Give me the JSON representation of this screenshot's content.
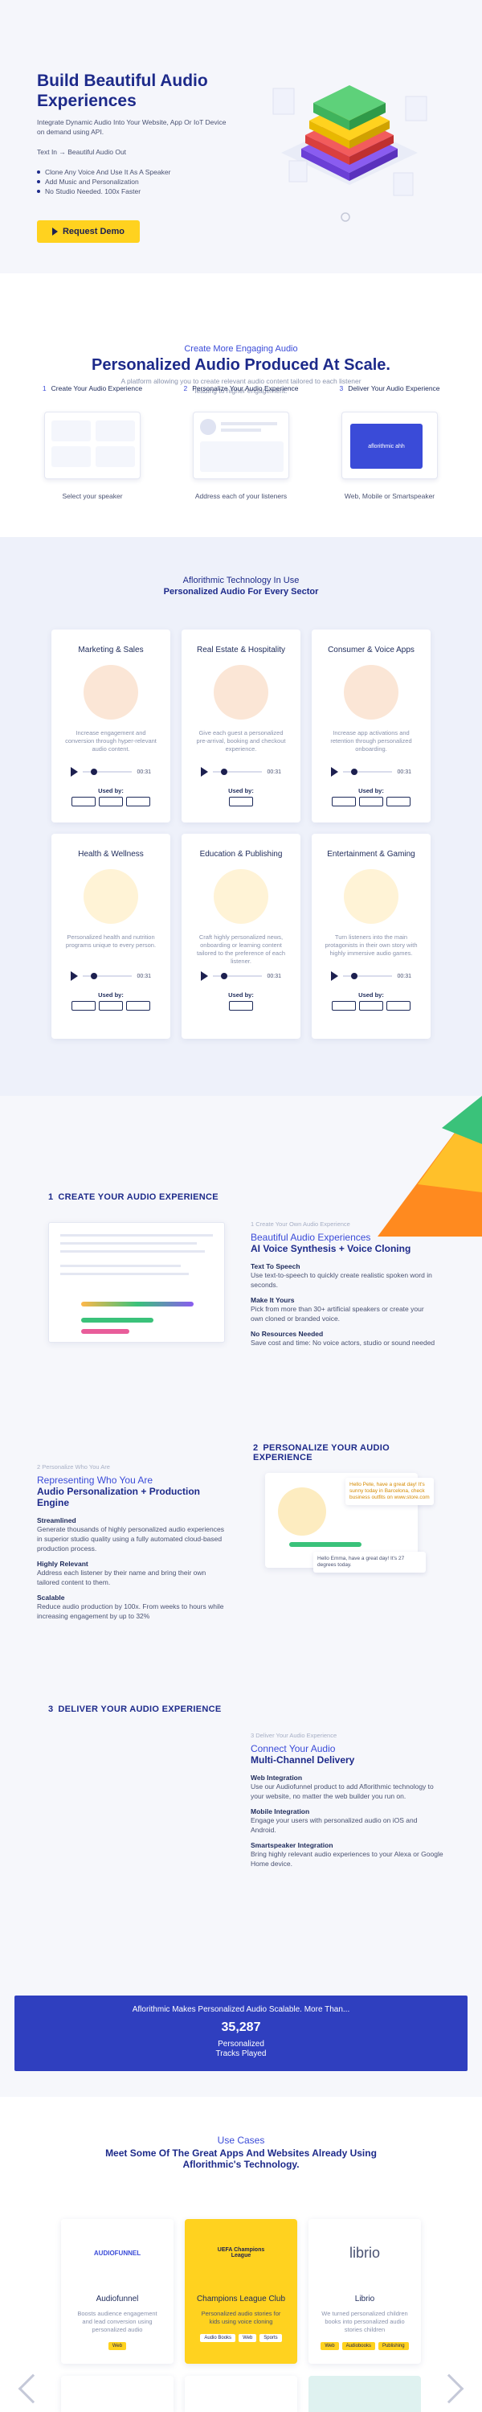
{
  "hero": {
    "title": "Build Beautiful Audio Experiences",
    "subtitle": "Integrate Dynamic Audio Into Your Website, App Or IoT Device on demand using API.",
    "flow": "Text In → Beautiful Audio Out",
    "bullets": [
      "Clone Any Voice And Use It As A Speaker",
      "Add Music and Personalization",
      "No Studio Needed. 100x Faster"
    ],
    "cta": "Request Demo"
  },
  "engaging": {
    "eyebrow": "Create More Engaging Audio",
    "title": "Personalized Audio Produced At Scale.",
    "description": "A platform allowing you to create relevant audio content tailored to each listener leading to higher engagement.",
    "steps": [
      {
        "number": "1",
        "title": "Create Your Audio Experience",
        "caption": "Select your speaker"
      },
      {
        "number": "2",
        "title": "Personalize Your Audio Experience",
        "caption": "Address each of your listeners"
      },
      {
        "number": "3",
        "title": "Deliver Your Audio Experience",
        "caption": "Web, Mobile or Smartspeaker"
      }
    ],
    "mock_text_3": "aflorithmic ahh"
  },
  "sectors": {
    "eyebrow": "Aflorithmic Technology In Use",
    "title": "Personalized Audio For Every Sector",
    "used_by": "Used by:",
    "time": "00:31",
    "cards": [
      {
        "title": "Marketing & Sales",
        "description": "Increase engagement and conversion through hyper-relevant audio content."
      },
      {
        "title": "Real Estate & Hospitality",
        "description": "Give each guest a personalized pre-arrival, booking and checkout experience."
      },
      {
        "title": "Consumer & Voice Apps",
        "description": "Increase app activations and retention through personalized onboarding."
      },
      {
        "title": "Health & Wellness",
        "description": "Personalized health and nutrition programs unique to every person."
      },
      {
        "title": "Education & Publishing",
        "description": "Craft highly personalized news, onboarding or learning content tailored to the preference of each listener."
      },
      {
        "title": "Entertainment & Gaming",
        "description": "Turn listeners into the main protagonists in their own story with highly immersive audio games."
      }
    ]
  },
  "features": {
    "create": {
      "heading_number": "1",
      "heading": "CREATE YOUR AUDIO EXPERIENCE",
      "eyebrow": "1 Create Your Own Audio Experience",
      "title_line1": "Beautiful Audio Experiences",
      "title_line2": "AI Voice Synthesis + Voice Cloning",
      "items": [
        {
          "h": "Text To Speech",
          "p": "Use text-to-speech to quickly create realistic spoken word in seconds."
        },
        {
          "h": "Make It Yours",
          "p": "Pick from more than 30+ artificial speakers or create your own cloned or branded voice."
        },
        {
          "h": "No Resources Needed",
          "p": "Save cost and time: No voice actors, studio or sound needed"
        }
      ]
    },
    "personalize": {
      "heading_number": "2",
      "heading": "PERSONALIZE YOUR AUDIO EXPERIENCE",
      "eyebrow": "2 Personalize Who You Are",
      "title_line1": "Representing Who You Are",
      "title_line2": "Audio Personalization + Production Engine",
      "items": [
        {
          "h": "Streamlined",
          "p": "Generate thousands of highly personalized audio experiences in superior studio quality using a fully automated cloud-based production process."
        },
        {
          "h": "Highly Relevant",
          "p": "Address each listener by their name and bring their own tailored content to them."
        },
        {
          "h": "Scalable",
          "p": "Reduce audio production by 100x. From weeks to hours while increasing engagement by up to 32%"
        }
      ],
      "bubble1": "Hello Pete, have a great day! It's sunny today in Barcelona, check business outfits on www.store.com",
      "bubble2": "Hello Emma, have a great day! It's 27 degrees today."
    },
    "deliver": {
      "heading_number": "3",
      "heading": "DELIVER YOUR AUDIO EXPERIENCE",
      "eyebrow": "3 Deliver Your Audio Experience",
      "title_line1": "Connect Your Audio",
      "title_line2": "Multi-Channel Delivery",
      "items": [
        {
          "h": "Web Integration",
          "p": "Use our Audiofunnel product to add Aflorithmic technology to your website, no matter the web builder you run on."
        },
        {
          "h": "Mobile Integration",
          "p": "Engage your users with personalized audio on iOS and Android."
        },
        {
          "h": "Smartspeaker Integration",
          "p": "Bring highly relevant audio experiences to your Alexa or Google Home device."
        }
      ]
    }
  },
  "stats": {
    "headline": "Aflorithmic Makes Personalized Audio Scalable. More Than...",
    "value": "35,287",
    "label1": "Personalized",
    "label2": "Tracks Played"
  },
  "use_cases": {
    "eyebrow": "Use Cases",
    "title": "Meet Some Of The Great Apps And Websites Already Using Aflorithmic's Technology.",
    "cards": [
      {
        "logo": "AUDIOFUNNEL",
        "name": "Audiofunnel",
        "description": "Boosts audience engagement and lead conversion using personalized audio",
        "tags": [
          "Web"
        ]
      },
      {
        "logo": "UEFA Champions League",
        "name": "Champions League Club",
        "description": "Personalized audio stories for kids using voice cloning",
        "tags": [
          "Audio Books",
          "Web",
          "Sports"
        ]
      },
      {
        "logo": "librio",
        "name": "Librio",
        "description": "We turned personalized children books into personalized audio stories children",
        "tags": [
          "Web",
          "Audiobooks",
          "Publishing"
        ]
      }
    ]
  },
  "colors": {
    "navy": "#1d2a8a",
    "accent_blue": "#3a4bd8",
    "yellow": "#ffd21f",
    "stats_bg": "#2f3fbf"
  }
}
